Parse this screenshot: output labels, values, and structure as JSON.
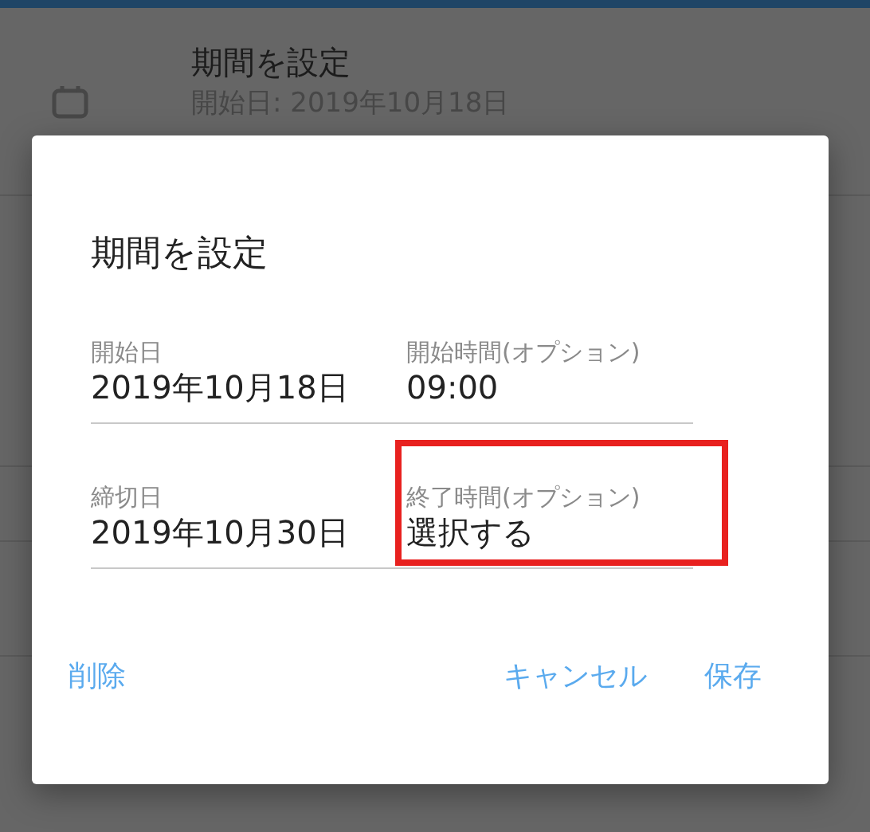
{
  "background_item": {
    "title": "期間を設定",
    "subtitle": "開始日: 2019年10月18日"
  },
  "dialog": {
    "title": "期間を設定",
    "fields": [
      {
        "label": "開始日",
        "value": "2019年10月18日",
        "highlighted": false
      },
      {
        "label": "開始時間(オプション)",
        "value": "09:00",
        "highlighted": false
      },
      {
        "label": "締切日",
        "value": "2019年10月30日",
        "highlighted": false
      },
      {
        "label": "終了時間(オプション)",
        "value": "選択する",
        "highlighted": true
      }
    ],
    "buttons": {
      "left": "削除",
      "right": [
        "キャンセル",
        "保存"
      ]
    }
  }
}
